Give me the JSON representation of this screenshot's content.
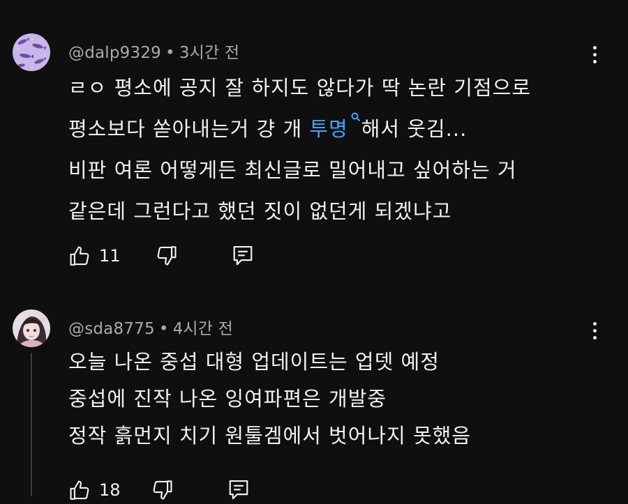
{
  "comments": [
    {
      "handle": "@dalp9329",
      "time": "3시간 전",
      "avatar_icon": "fish-pattern-avatar",
      "lines": [
        "ㄹㅇ 평소에 공지 잘 하지도 않다가 딱 논란 기점으로",
        "평소보다 쏟아내는거 걍 개 ",
        "비판 여론 어떻게든 최신글로 밀어내고 싶어하는 거",
        "같은데 그런다고 했던 짓이 없던게 되겠냐고"
      ],
      "hashtag": "투명",
      "line2_suffix": "해서 웃김...",
      "likes": "11"
    },
    {
      "handle": "@sda8775",
      "time": "4시간 전",
      "avatar_icon": "anime-girl-avatar",
      "lines": [
        "오늘 나온 중섭 대형 업데이트는 업뎃 예정",
        "중섭에 진작 나온 잉여파편은 개발중",
        "정작 흙먼지 치기 원툴겜에서 벗어나지 못했음"
      ],
      "likes": "18"
    }
  ],
  "meta_separator": "•",
  "colors": {
    "background": "#0f0f0f",
    "text": "#f1f1f1",
    "secondary_text": "#aaaaaa",
    "link": "#3ea6ff"
  }
}
